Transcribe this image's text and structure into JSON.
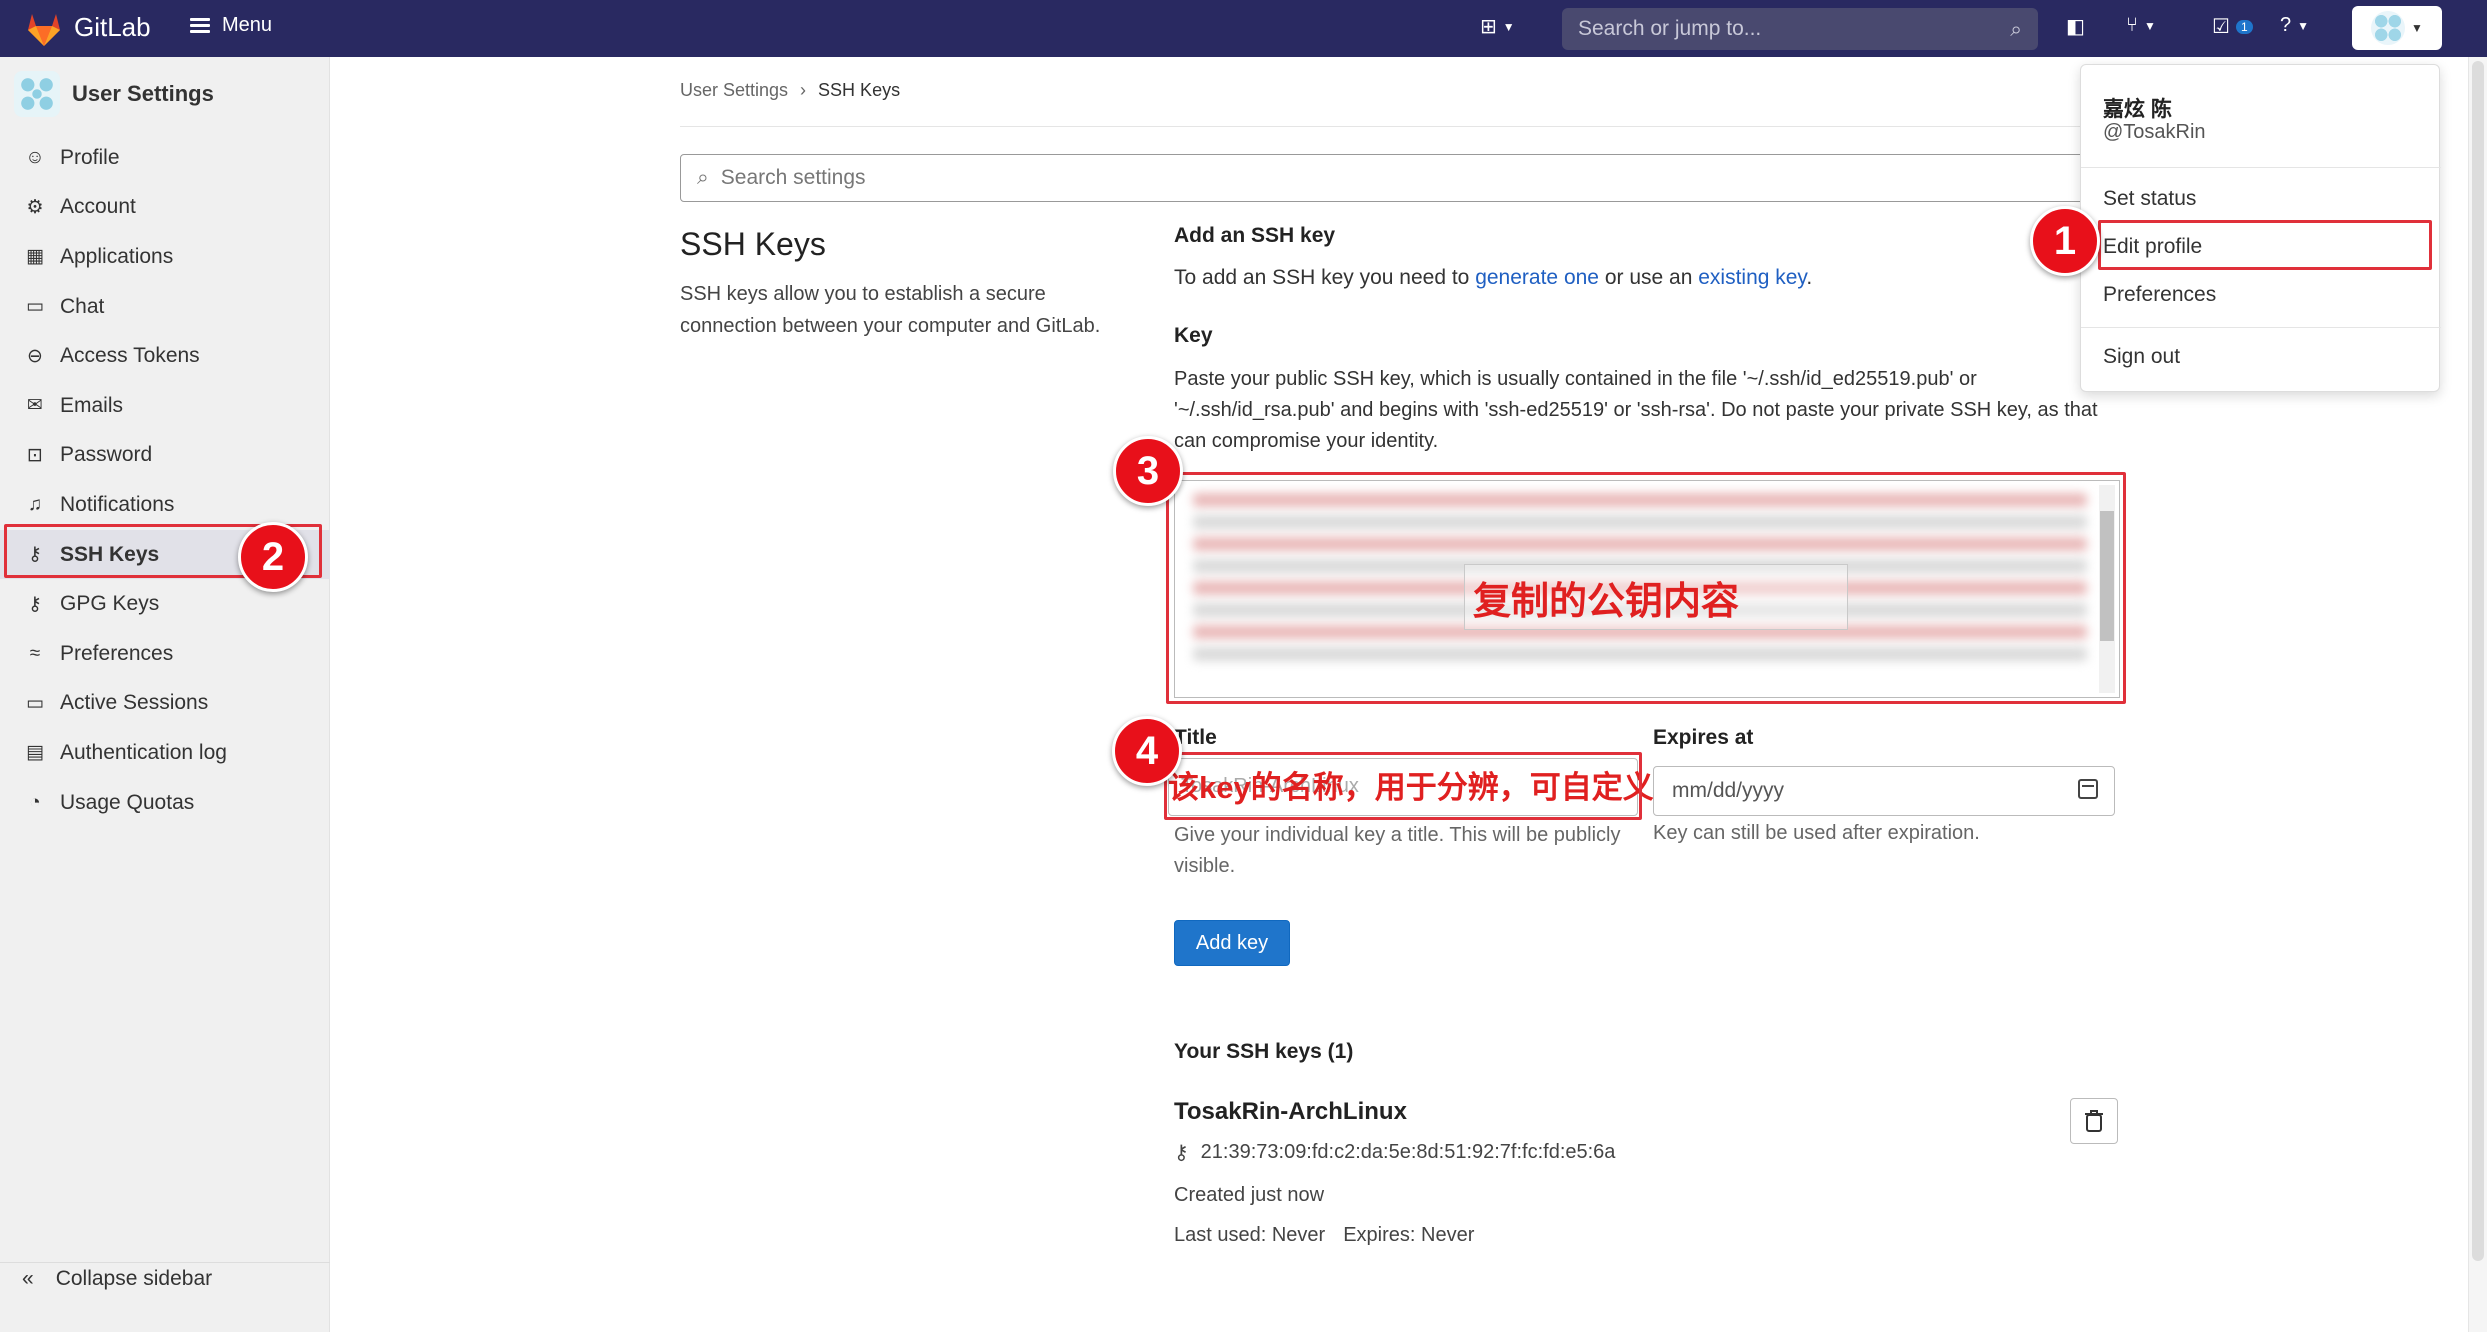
{
  "topbar": {
    "brand": "GitLab",
    "menu_label": "Menu",
    "search_placeholder": "Search or jump to...",
    "todo_count": "1",
    "colors": {
      "bg": "#292961",
      "accent": "#1f75cb"
    }
  },
  "sidebar": {
    "title": "User Settings",
    "items": [
      {
        "label": "Profile",
        "icon": "profile-icon"
      },
      {
        "label": "Account",
        "icon": "account-icon"
      },
      {
        "label": "Applications",
        "icon": "applications-icon"
      },
      {
        "label": "Chat",
        "icon": "chat-icon"
      },
      {
        "label": "Access Tokens",
        "icon": "token-icon"
      },
      {
        "label": "Emails",
        "icon": "mail-icon"
      },
      {
        "label": "Password",
        "icon": "lock-icon"
      },
      {
        "label": "Notifications",
        "icon": "bell-icon"
      },
      {
        "label": "SSH Keys",
        "icon": "key-icon",
        "active": true
      },
      {
        "label": "GPG Keys",
        "icon": "key-icon"
      },
      {
        "label": "Preferences",
        "icon": "preferences-icon"
      },
      {
        "label": "Active Sessions",
        "icon": "monitor-icon"
      },
      {
        "label": "Authentication log",
        "icon": "log-icon"
      },
      {
        "label": "Usage Quotas",
        "icon": "quota-icon"
      }
    ],
    "collapse_label": "Collapse sidebar"
  },
  "breadcrumb": {
    "parent": "User Settings",
    "separator": "›",
    "current": "SSH Keys"
  },
  "settings_search": {
    "placeholder": "Search settings"
  },
  "section": {
    "title": "SSH Keys",
    "description": "SSH keys allow you to establish a secure connection between your computer and GitLab."
  },
  "add_key": {
    "heading": "Add an SSH key",
    "intro_prefix": "To add an SSH key you need to ",
    "link_generate": "generate one",
    "intro_middle": " or use an ",
    "link_existing": "existing key",
    "intro_suffix": ".",
    "key_label": "Key",
    "key_help": "Paste your public SSH key, which is usually contained in the file '~/.ssh/id_ed25519.pub' or '~/.ssh/id_rsa.pub' and begins with 'ssh-ed25519' or 'ssh-rsa'. Do not paste your private SSH key, as that can compromise your identity.",
    "key_overlay": "复制的公钥内容",
    "title_label": "Title",
    "title_value": "TosakRin-ArchLinux",
    "title_overlay": "该key的名称，用于分辨，可自定义",
    "title_help": "Give your individual key a title. This will be publicly visible.",
    "expires_label": "Expires at",
    "expires_placeholder": "mm/dd/yyyy",
    "expires_help": "Key can still be used after expiration.",
    "add_button": "Add key"
  },
  "your_keys": {
    "heading": "Your SSH keys (1)",
    "keys": [
      {
        "name": "TosakRin-ArchLinux",
        "fingerprint": "21:39:73:09:fd:c2:da:5e:8d:51:92:7f:fc:fd:e5:6a",
        "created": "Created just now",
        "last_used": "Last used: Never",
        "expires": "Expires: Never"
      }
    ]
  },
  "user_menu": {
    "name": "嘉炫 陈",
    "handle": "@TosakRin",
    "items": [
      "Set status",
      "Edit profile",
      "Preferences",
      "Sign out"
    ]
  },
  "annotations": [
    "1",
    "2",
    "3",
    "4"
  ]
}
